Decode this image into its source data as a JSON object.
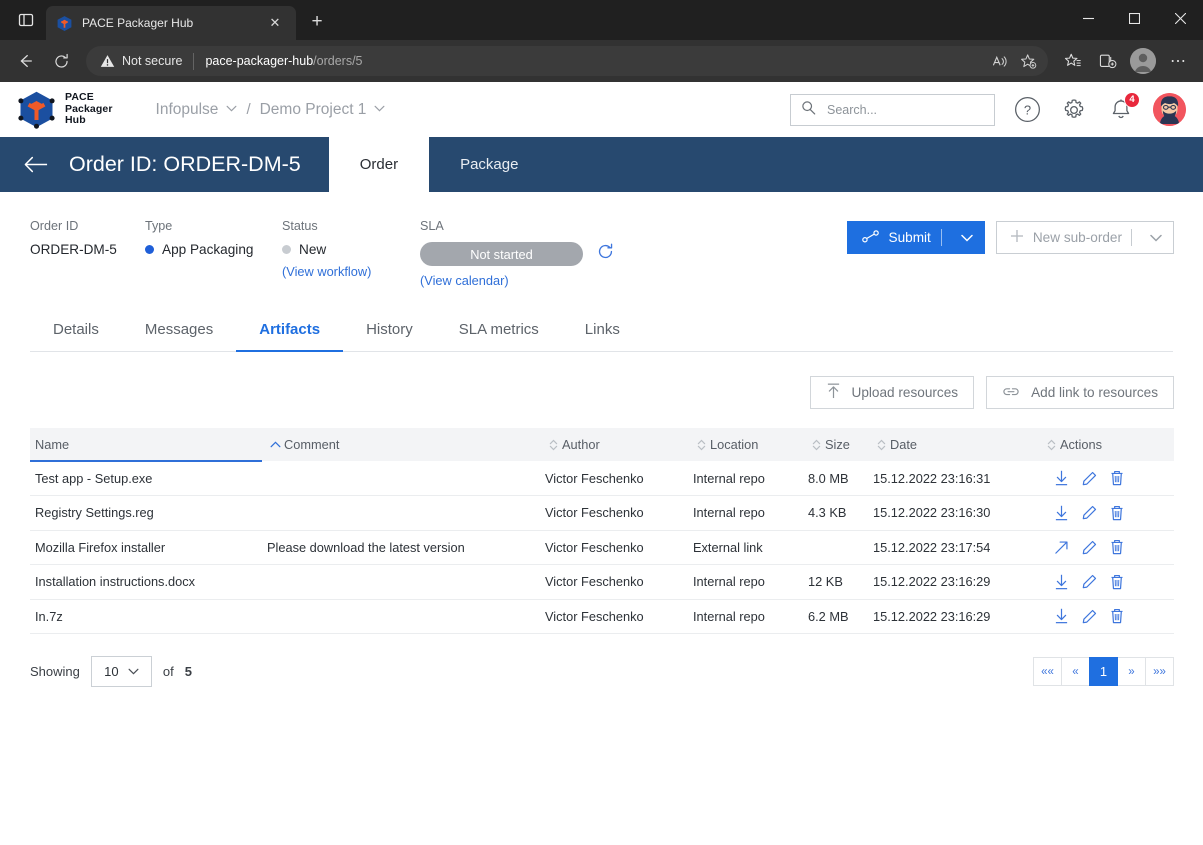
{
  "browser": {
    "tab_title": "PACE Packager Hub",
    "tab_close_label": "✕",
    "new_tab_label": "+",
    "back_label": "←",
    "reload_label": "↻",
    "security_label": "Not secure",
    "url_host": "pace-packager-hub",
    "url_path": "/orders/5",
    "window_minimize": "—",
    "window_maximize": "☐",
    "window_close": "✕",
    "more_label": "⋯"
  },
  "header": {
    "logo_line1": "PACE",
    "logo_line2": "Packager",
    "logo_line3": "Hub",
    "breadcrumb": [
      {
        "label": "Infopulse",
        "chevron": "⌄"
      },
      {
        "label": "Demo Project 1",
        "chevron": "⌄"
      }
    ],
    "breadcrumb_separator": "/",
    "search": {
      "placeholder": "Search...",
      "value": ""
    },
    "help_label": "?",
    "notifications_count": "4"
  },
  "order_bar": {
    "back_label": "←",
    "title": "Order ID: ORDER-DM-5",
    "tabs": [
      {
        "label": "Order",
        "active": true
      },
      {
        "label": "Package",
        "active": false
      }
    ]
  },
  "meta": {
    "order_id": {
      "label": "Order ID",
      "value": "ORDER-DM-5"
    },
    "type": {
      "label": "Type",
      "value": "App Packaging",
      "dot_color": "#1f5fd8"
    },
    "status": {
      "label": "Status",
      "value": "New",
      "dot_color": "#c8ccd1",
      "link": "(View workflow)"
    },
    "sla": {
      "label": "SLA",
      "value": "Not started",
      "pill_color": "#a3a7ad",
      "link": "(View calendar)"
    },
    "submit_button": "Submit",
    "new_sub_order_button": "New sub-order",
    "dropdown_chevron": "⌄"
  },
  "tabs": [
    {
      "label": "Details",
      "active": false
    },
    {
      "label": "Messages",
      "active": false
    },
    {
      "label": "Artifacts",
      "active": true
    },
    {
      "label": "History",
      "active": false
    },
    {
      "label": "SLA metrics",
      "active": false
    },
    {
      "label": "Links",
      "active": false
    }
  ],
  "table_tools": {
    "upload_button": "Upload resources",
    "add_link_button": "Add link to resources"
  },
  "table": {
    "columns": [
      {
        "label": "Name",
        "sorted": "asc"
      },
      {
        "label": "Comment",
        "sorted": "none"
      },
      {
        "label": "Author",
        "sorted": "none"
      },
      {
        "label": "Location",
        "sorted": "none"
      },
      {
        "label": "Size",
        "sorted": "none"
      },
      {
        "label": "Date",
        "sorted": "none"
      },
      {
        "label": "Actions",
        "sorted": "none"
      }
    ],
    "rows": [
      {
        "name": "Test app - Setup.exe",
        "is_link": false,
        "comment": "",
        "author": "Victor Feschenko",
        "location": "Internal repo",
        "size": "8.0 MB",
        "date": "15.12.2022 23:16:31",
        "first_action": "download"
      },
      {
        "name": "Registry Settings.reg",
        "is_link": false,
        "comment": "",
        "author": "Victor Feschenko",
        "location": "Internal repo",
        "size": "4.3 KB",
        "date": "15.12.2022 23:16:30",
        "first_action": "download"
      },
      {
        "name": "Mozilla Firefox installer",
        "is_link": true,
        "comment": "Please download the latest version",
        "author": "Victor Feschenko",
        "location": "External link",
        "size": "",
        "date": "15.12.2022 23:17:54",
        "first_action": "external"
      },
      {
        "name": "Installation instructions.docx",
        "is_link": false,
        "comment": "",
        "author": "Victor Feschenko",
        "location": "Internal repo",
        "size": "12 KB",
        "date": "15.12.2022 23:16:29",
        "first_action": "download"
      },
      {
        "name": "In.7z",
        "is_link": false,
        "comment": "",
        "author": "Victor Feschenko",
        "location": "Internal repo",
        "size": "6.2 MB",
        "date": "15.12.2022 23:16:29",
        "first_action": "download"
      }
    ]
  },
  "pagination": {
    "showing_label": "Showing",
    "page_size": "10",
    "of_label": "of",
    "total": "5",
    "first_label": "««",
    "prev_label": "«",
    "current_page": "1",
    "next_label": "»",
    "last_label": "»»"
  },
  "colors": {
    "accent_blue": "#1f6fe0",
    "header_navy": "#27496f",
    "link_blue": "#3e76dd",
    "badge_red": "#e8283c"
  }
}
